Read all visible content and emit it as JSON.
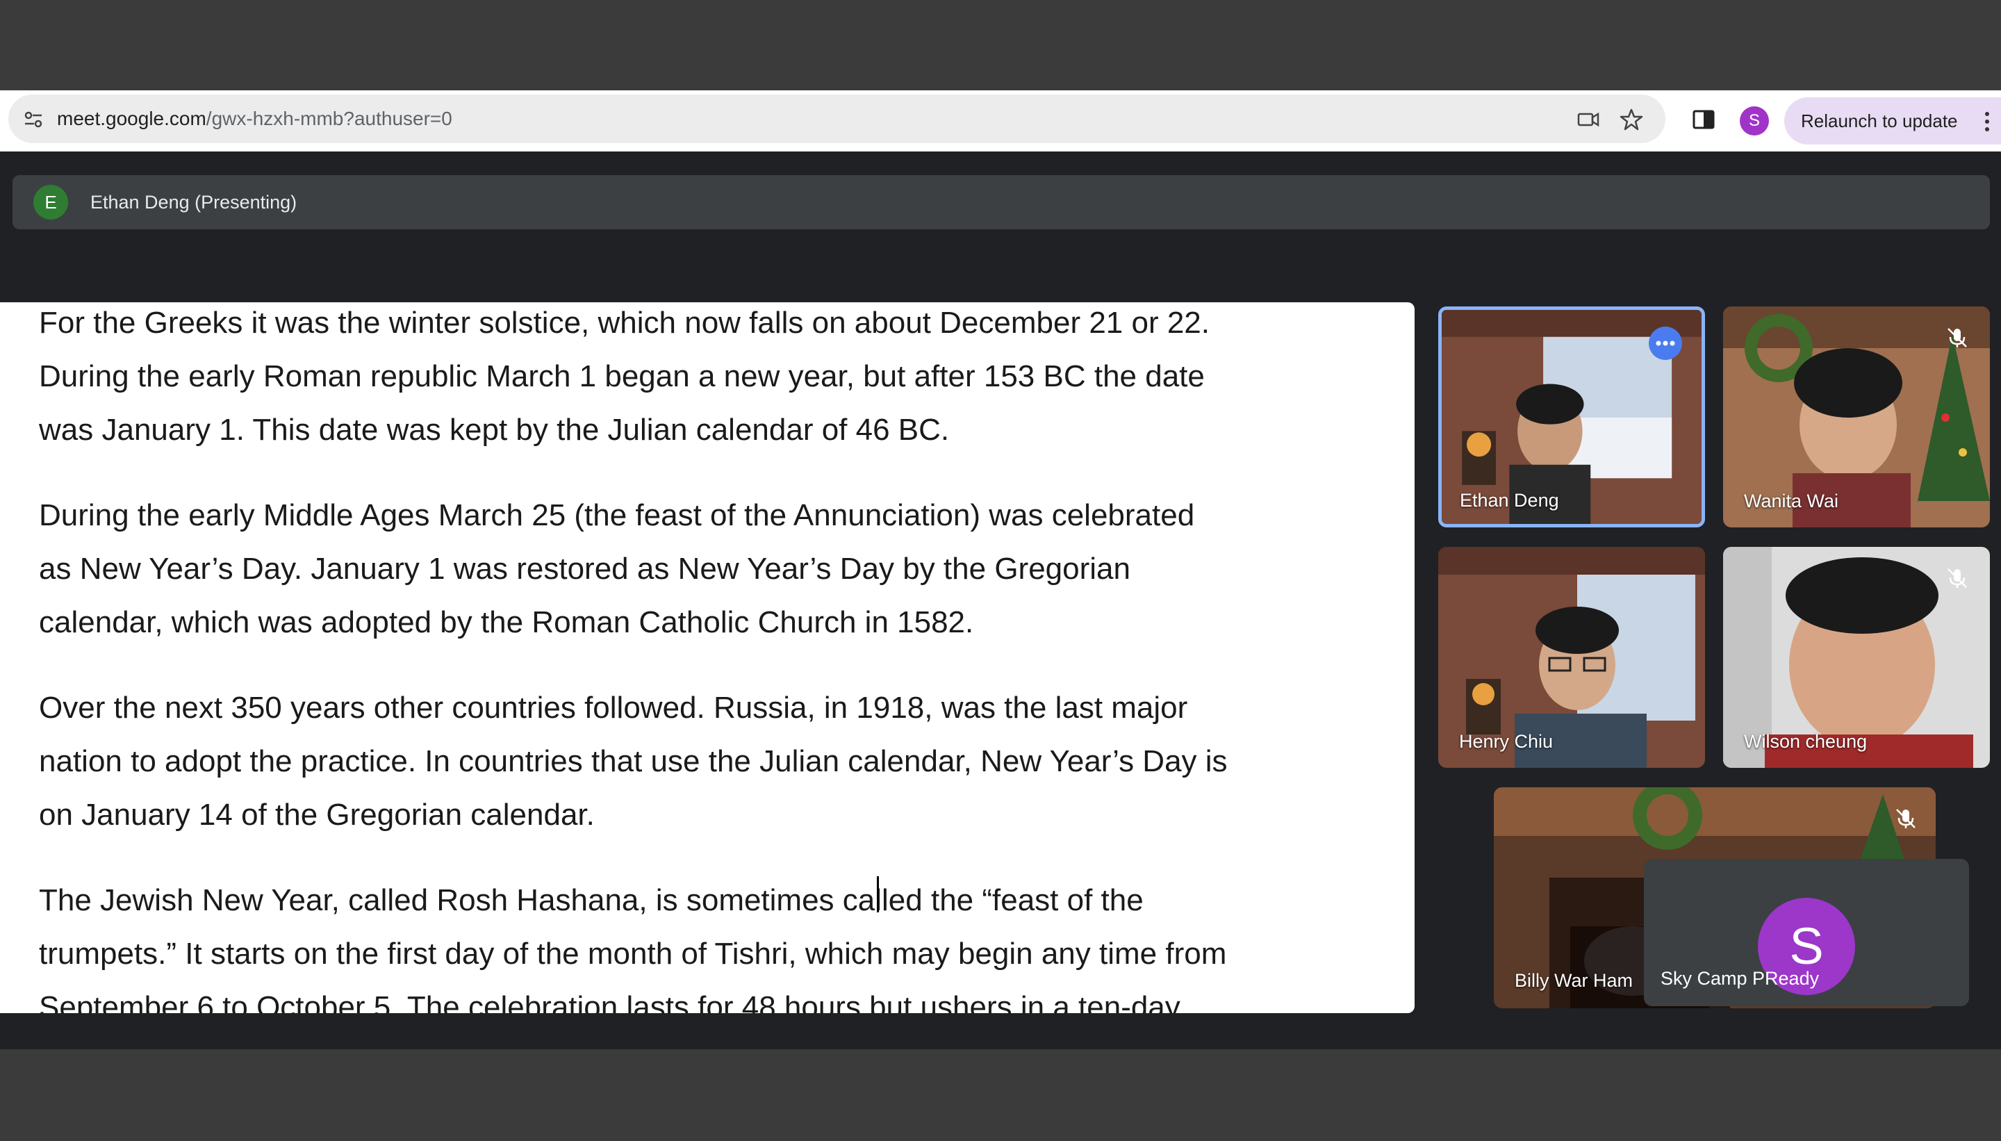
{
  "browser": {
    "url_host": "meet.google.com",
    "url_path": "/gwx-hzxh-mmb?authuser=0",
    "profile_initial": "S",
    "relaunch_label": "Relaunch to update"
  },
  "presenter": {
    "initial": "E",
    "name": "Ethan Deng (Presenting)"
  },
  "document": {
    "paragraphs": [
      "For the Greeks it was the winter solstice, which now falls on about December 21 or 22.\nDuring the early Roman republic March 1 began a new year, but after 153 BC the date\nwas January 1. This date was kept by the Julian calendar of 46 BC.",
      "During the early Middle Ages March 25 (the feast of the Annunciation) was celebrated\nas New Year’s Day. January 1 was restored as New Year’s Day by the Gregorian\ncalendar, which was adopted by the Roman Catholic Church in 1582.",
      "Over the next 350 years other countries followed. Russia, in 1918, was the last major\nnation to adopt the practice. In countries that use the Julian calendar, New Year’s Day is\non January 14 of the Gregorian calendar.",
      "The Jewish New Year, called Rosh Hashana, is sometimes called the “feast of the\ntrumpets.” It starts on the first day of the month of Tishri, which may begin any time from\nSeptember 6 to October 5. The celebration lasts for 48 hours but ushers in a ten-day"
    ]
  },
  "participants": [
    {
      "name": "Ethan Deng",
      "active_speaker": true,
      "muted": false
    },
    {
      "name": "Wanita Wai",
      "muted": true
    },
    {
      "name": "Henry Chiu",
      "muted": false
    },
    {
      "name": "Wilson cheung",
      "muted": true
    },
    {
      "name": "Billy War Ham",
      "muted": true
    },
    {
      "name": "Sky Camp PReady",
      "initial": "S",
      "muted": false
    }
  ],
  "colors": {
    "active_speaker_border": "#8ab4f8",
    "avatar_purple": "#9c37c9",
    "presenter_avatar": "#2e7d32",
    "relaunch_bg": "#e8dcf4"
  }
}
